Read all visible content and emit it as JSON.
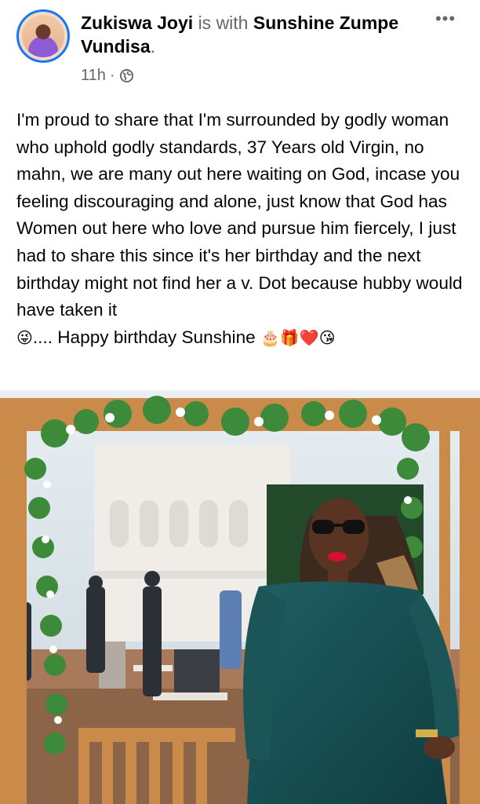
{
  "post": {
    "author": "Zukiswa Joyi",
    "with_text": "is with",
    "tagged_name": "Sunshine Zumpe Vundisa",
    "period": ".",
    "time": "11h",
    "separator": "·",
    "privacy_icon": "globe-icon",
    "more_label": "•••",
    "body_text": "I'm proud to share that I'm surrounded by godly woman who uphold godly standards, 37 Years old Virgin, no mahn, we are many out here waiting on God, incase you feeling discouraging and alone, just know that God has Women out here who love and pursue him fiercely, I just had to share this since it's her birthday and the next birthday might not find her a v. Dot because hubby would have taken it",
    "body_emoji_1": "😜",
    "body_tail": ".... Happy birthday Sunshine",
    "end_emojis": "🎂🎁❤️😘"
  },
  "colors": {
    "accent_ring": "#1877f2",
    "muted_text": "#65676b"
  }
}
